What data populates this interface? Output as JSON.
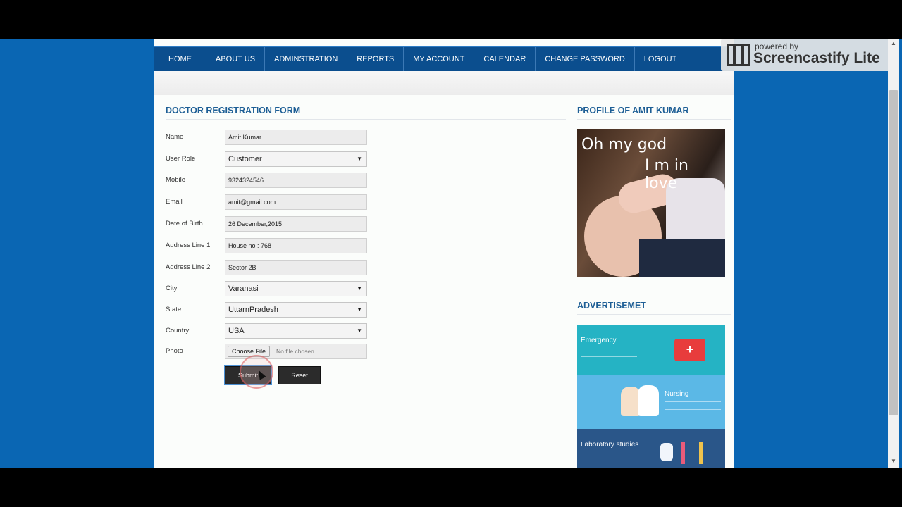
{
  "nav": {
    "items": [
      "HOME",
      "ABOUT US",
      "ADMINSTRATION",
      "REPORTS",
      "MY ACCOUNT",
      "CALENDAR",
      "CHANGE PASSWORD",
      "LOGOUT"
    ]
  },
  "form": {
    "title": "DOCTOR REGISTRATION FORM",
    "fields": [
      {
        "label": "Name",
        "value": "Amit Kumar",
        "kind": "text"
      },
      {
        "label": "User Role",
        "value": "Customer",
        "kind": "select"
      },
      {
        "label": "Mobile",
        "value": "9324324546",
        "kind": "text"
      },
      {
        "label": "Email",
        "value": "amit@gmail.com",
        "kind": "text"
      },
      {
        "label": "Date of Birth",
        "value": "26 December,2015",
        "kind": "text"
      },
      {
        "label": "Address Line 1",
        "value": "House no : 768",
        "kind": "text"
      },
      {
        "label": "Address Line 2",
        "value": "Sector 2B",
        "kind": "text"
      },
      {
        "label": "City",
        "value": "Varanasi",
        "kind": "select"
      },
      {
        "label": "State",
        "value": "UttarnPradesh",
        "kind": "select"
      },
      {
        "label": "Country",
        "value": "USA",
        "kind": "select"
      },
      {
        "label": "Photo",
        "kind": "file",
        "button": "Choose File",
        "status": "No file chosen"
      }
    ],
    "submit_label": "Submit",
    "reset_label": "Reset"
  },
  "sidebar": {
    "profile_title": "PROFILE OF AMIT KUMAR",
    "photo_caption_line1": "Oh my god",
    "photo_caption_line2": "I m in love",
    "ad_title": "ADVERTISEMET",
    "ad_labels": [
      "Emergency",
      "Nursing",
      "Laboratory studies"
    ]
  },
  "branding": {
    "powered_by": "powered by",
    "name": "Screencastify Lite"
  },
  "colors": {
    "nav": "#0b4e8e",
    "page_background": "#0a66b3",
    "title": "#1d5e95",
    "button": "#2b2b2b"
  },
  "icons": {
    "select_arrow": "triangle-down",
    "brand": "film-strip-icon",
    "scroll_up": "up-arrow-icon",
    "scroll_down": "down-arrow-icon"
  }
}
